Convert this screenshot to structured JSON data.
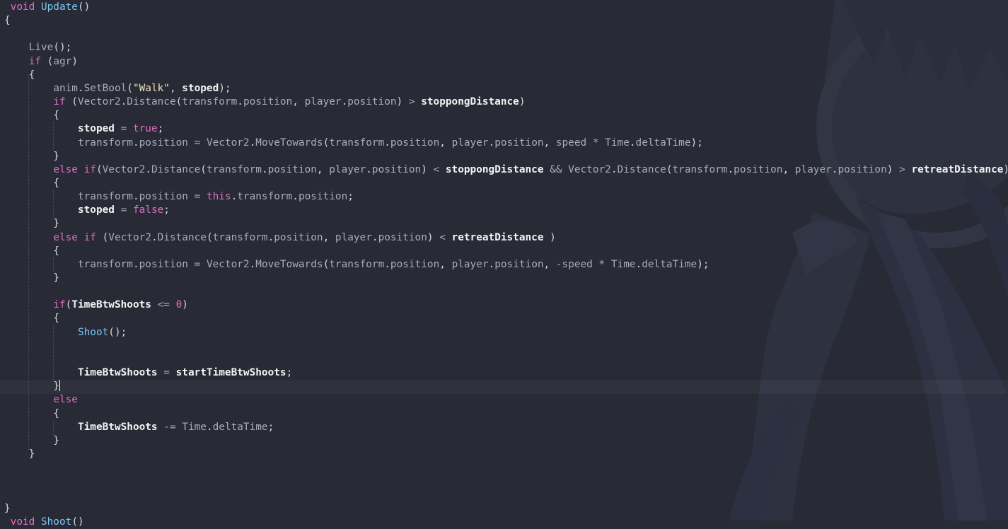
{
  "editor": {
    "language": "C#",
    "colors": {
      "background": "#282a35",
      "keyword": "#e06ec2",
      "function": "#79c7f2",
      "member": "#a9adb6",
      "string": "#e9e3c0",
      "bold_var": "#f3f3f3",
      "text": "#b8bcc6"
    },
    "lines": [
      [
        [
          "kw",
          " void "
        ],
        [
          "fn",
          "Update"
        ],
        [
          "pn",
          "()"
        ]
      ],
      [
        [
          "pn",
          "{"
        ]
      ],
      [],
      [
        [
          "pn",
          "    "
        ],
        [
          "mt",
          "Live"
        ],
        [
          "pn",
          "();"
        ]
      ],
      [
        [
          "pn",
          "    "
        ],
        [
          "kw",
          "if"
        ],
        [
          "pn",
          " ("
        ],
        [
          "mt",
          "agr"
        ],
        [
          "pn",
          ")"
        ]
      ],
      [
        [
          "pn",
          "    {"
        ]
      ],
      [
        [
          "pn",
          "        "
        ],
        [
          "mt",
          "anim"
        ],
        [
          "pn",
          "."
        ],
        [
          "mt",
          "SetBool"
        ],
        [
          "pn",
          "("
        ],
        [
          "str",
          "\"Walk\""
        ],
        [
          "pn",
          ", "
        ],
        [
          "var",
          "stoped"
        ],
        [
          "pn",
          ");"
        ]
      ],
      [
        [
          "pn",
          "        "
        ],
        [
          "kw",
          "if"
        ],
        [
          "pn",
          " ("
        ],
        [
          "mt",
          "Vector2"
        ],
        [
          "pn",
          "."
        ],
        [
          "mt",
          "Distance"
        ],
        [
          "pn",
          "("
        ],
        [
          "mt",
          "transform"
        ],
        [
          "pn",
          "."
        ],
        [
          "mt",
          "position"
        ],
        [
          "pn",
          ", "
        ],
        [
          "mt",
          "player"
        ],
        [
          "pn",
          "."
        ],
        [
          "mt",
          "position"
        ],
        [
          "pn",
          ") "
        ],
        [
          "op",
          ">"
        ],
        [
          "pn",
          " "
        ],
        [
          "var",
          "stoppongDistance"
        ],
        [
          "pn",
          ")"
        ]
      ],
      [
        [
          "pn",
          "        {"
        ]
      ],
      [
        [
          "pn",
          "            "
        ],
        [
          "var",
          "stoped"
        ],
        [
          "pn",
          " "
        ],
        [
          "op",
          "="
        ],
        [
          "pn",
          " "
        ],
        [
          "kw",
          "true"
        ],
        [
          "pn",
          ";"
        ]
      ],
      [
        [
          "pn",
          "            "
        ],
        [
          "mt",
          "transform"
        ],
        [
          "pn",
          "."
        ],
        [
          "mt",
          "position"
        ],
        [
          "pn",
          " "
        ],
        [
          "op",
          "="
        ],
        [
          "pn",
          " "
        ],
        [
          "mt",
          "Vector2"
        ],
        [
          "pn",
          "."
        ],
        [
          "mt",
          "MoveTowards"
        ],
        [
          "pn",
          "("
        ],
        [
          "mt",
          "transform"
        ],
        [
          "pn",
          "."
        ],
        [
          "mt",
          "position"
        ],
        [
          "pn",
          ", "
        ],
        [
          "mt",
          "player"
        ],
        [
          "pn",
          "."
        ],
        [
          "mt",
          "position"
        ],
        [
          "pn",
          ", "
        ],
        [
          "mt",
          "speed"
        ],
        [
          "pn",
          " "
        ],
        [
          "op",
          "*"
        ],
        [
          "pn",
          " "
        ],
        [
          "mt",
          "Time"
        ],
        [
          "pn",
          "."
        ],
        [
          "mt",
          "deltaTime"
        ],
        [
          "pn",
          ");"
        ]
      ],
      [
        [
          "pn",
          "        }"
        ]
      ],
      [
        [
          "pn",
          "        "
        ],
        [
          "kw",
          "else if"
        ],
        [
          "pn",
          "("
        ],
        [
          "mt",
          "Vector2"
        ],
        [
          "pn",
          "."
        ],
        [
          "mt",
          "Distance"
        ],
        [
          "pn",
          "("
        ],
        [
          "mt",
          "transform"
        ],
        [
          "pn",
          "."
        ],
        [
          "mt",
          "position"
        ],
        [
          "pn",
          ", "
        ],
        [
          "mt",
          "player"
        ],
        [
          "pn",
          "."
        ],
        [
          "mt",
          "position"
        ],
        [
          "pn",
          ") "
        ],
        [
          "op",
          "<"
        ],
        [
          "pn",
          " "
        ],
        [
          "var",
          "stoppongDistance"
        ],
        [
          "pn",
          " "
        ],
        [
          "op",
          "&&"
        ],
        [
          "pn",
          " "
        ],
        [
          "mt",
          "Vector2"
        ],
        [
          "pn",
          "."
        ],
        [
          "mt",
          "Distance"
        ],
        [
          "pn",
          "("
        ],
        [
          "mt",
          "transform"
        ],
        [
          "pn",
          "."
        ],
        [
          "mt",
          "position"
        ],
        [
          "pn",
          ", "
        ],
        [
          "mt",
          "player"
        ],
        [
          "pn",
          "."
        ],
        [
          "mt",
          "position"
        ],
        [
          "pn",
          ") "
        ],
        [
          "op",
          ">"
        ],
        [
          "pn",
          " "
        ],
        [
          "var",
          "retreatDistance"
        ],
        [
          "pn",
          ")"
        ]
      ],
      [
        [
          "pn",
          "        {"
        ]
      ],
      [
        [
          "pn",
          "            "
        ],
        [
          "mt",
          "transform"
        ],
        [
          "pn",
          "."
        ],
        [
          "mt",
          "position"
        ],
        [
          "pn",
          " "
        ],
        [
          "op",
          "="
        ],
        [
          "pn",
          " "
        ],
        [
          "kw",
          "this"
        ],
        [
          "pn",
          "."
        ],
        [
          "mt",
          "transform"
        ],
        [
          "pn",
          "."
        ],
        [
          "mt",
          "position"
        ],
        [
          "pn",
          ";"
        ]
      ],
      [
        [
          "pn",
          "            "
        ],
        [
          "var",
          "stoped"
        ],
        [
          "pn",
          " "
        ],
        [
          "op",
          "="
        ],
        [
          "pn",
          " "
        ],
        [
          "kw",
          "false"
        ],
        [
          "pn",
          ";"
        ]
      ],
      [
        [
          "pn",
          "        }"
        ]
      ],
      [
        [
          "pn",
          "        "
        ],
        [
          "kw",
          "else if"
        ],
        [
          "pn",
          " ("
        ],
        [
          "mt",
          "Vector2"
        ],
        [
          "pn",
          "."
        ],
        [
          "mt",
          "Distance"
        ],
        [
          "pn",
          "("
        ],
        [
          "mt",
          "transform"
        ],
        [
          "pn",
          "."
        ],
        [
          "mt",
          "position"
        ],
        [
          "pn",
          ", "
        ],
        [
          "mt",
          "player"
        ],
        [
          "pn",
          "."
        ],
        [
          "mt",
          "position"
        ],
        [
          "pn",
          ") "
        ],
        [
          "op",
          "<"
        ],
        [
          "pn",
          " "
        ],
        [
          "var",
          "retreatDistance"
        ],
        [
          "pn",
          " )"
        ]
      ],
      [
        [
          "pn",
          "        {"
        ]
      ],
      [
        [
          "pn",
          "            "
        ],
        [
          "mt",
          "transform"
        ],
        [
          "pn",
          "."
        ],
        [
          "mt",
          "position"
        ],
        [
          "pn",
          " "
        ],
        [
          "op",
          "="
        ],
        [
          "pn",
          " "
        ],
        [
          "mt",
          "Vector2"
        ],
        [
          "pn",
          "."
        ],
        [
          "mt",
          "MoveTowards"
        ],
        [
          "pn",
          "("
        ],
        [
          "mt",
          "transform"
        ],
        [
          "pn",
          "."
        ],
        [
          "mt",
          "position"
        ],
        [
          "pn",
          ", "
        ],
        [
          "mt",
          "player"
        ],
        [
          "pn",
          "."
        ],
        [
          "mt",
          "position"
        ],
        [
          "pn",
          ", "
        ],
        [
          "op",
          "-"
        ],
        [
          "mt",
          "speed"
        ],
        [
          "pn",
          " "
        ],
        [
          "op",
          "*"
        ],
        [
          "pn",
          " "
        ],
        [
          "mt",
          "Time"
        ],
        [
          "pn",
          "."
        ],
        [
          "mt",
          "deltaTime"
        ],
        [
          "pn",
          ");"
        ]
      ],
      [
        [
          "pn",
          "        }"
        ]
      ],
      [],
      [
        [
          "pn",
          "        "
        ],
        [
          "kw",
          "if"
        ],
        [
          "pn",
          "("
        ],
        [
          "var",
          "TimeBtwShoots"
        ],
        [
          "pn",
          " "
        ],
        [
          "op",
          "<="
        ],
        [
          "pn",
          " "
        ],
        [
          "num",
          "0"
        ],
        [
          "pn",
          ")"
        ]
      ],
      [
        [
          "pn",
          "        {"
        ]
      ],
      [
        [
          "pn",
          "            "
        ],
        [
          "fn",
          "Shoot"
        ],
        [
          "pn",
          "();"
        ]
      ],
      [],
      [],
      [
        [
          "pn",
          "            "
        ],
        [
          "var",
          "TimeBtwShoots"
        ],
        [
          "pn",
          " "
        ],
        [
          "op",
          "="
        ],
        [
          "pn",
          " "
        ],
        [
          "var",
          "startTimeBtwShoots"
        ],
        [
          "pn",
          ";"
        ]
      ],
      [
        [
          "pn",
          "        }"
        ],
        [
          "caret",
          ""
        ]
      ],
      [
        [
          "pn",
          "        "
        ],
        [
          "kw",
          "else"
        ]
      ],
      [
        [
          "pn",
          "        {"
        ]
      ],
      [
        [
          "pn",
          "            "
        ],
        [
          "var",
          "TimeBtwShoots"
        ],
        [
          "pn",
          " "
        ],
        [
          "op",
          "-="
        ],
        [
          "pn",
          " "
        ],
        [
          "mt",
          "Time"
        ],
        [
          "pn",
          "."
        ],
        [
          "mt",
          "deltaTime"
        ],
        [
          "pn",
          ";"
        ]
      ],
      [
        [
          "pn",
          "        }"
        ]
      ],
      [
        [
          "pn",
          "    }"
        ]
      ],
      [],
      [],
      [],
      [
        [
          "pn",
          "}"
        ]
      ],
      [
        [
          "kw",
          " void "
        ],
        [
          "fn",
          "Shoot"
        ],
        [
          "pn",
          "()"
        ]
      ]
    ]
  }
}
